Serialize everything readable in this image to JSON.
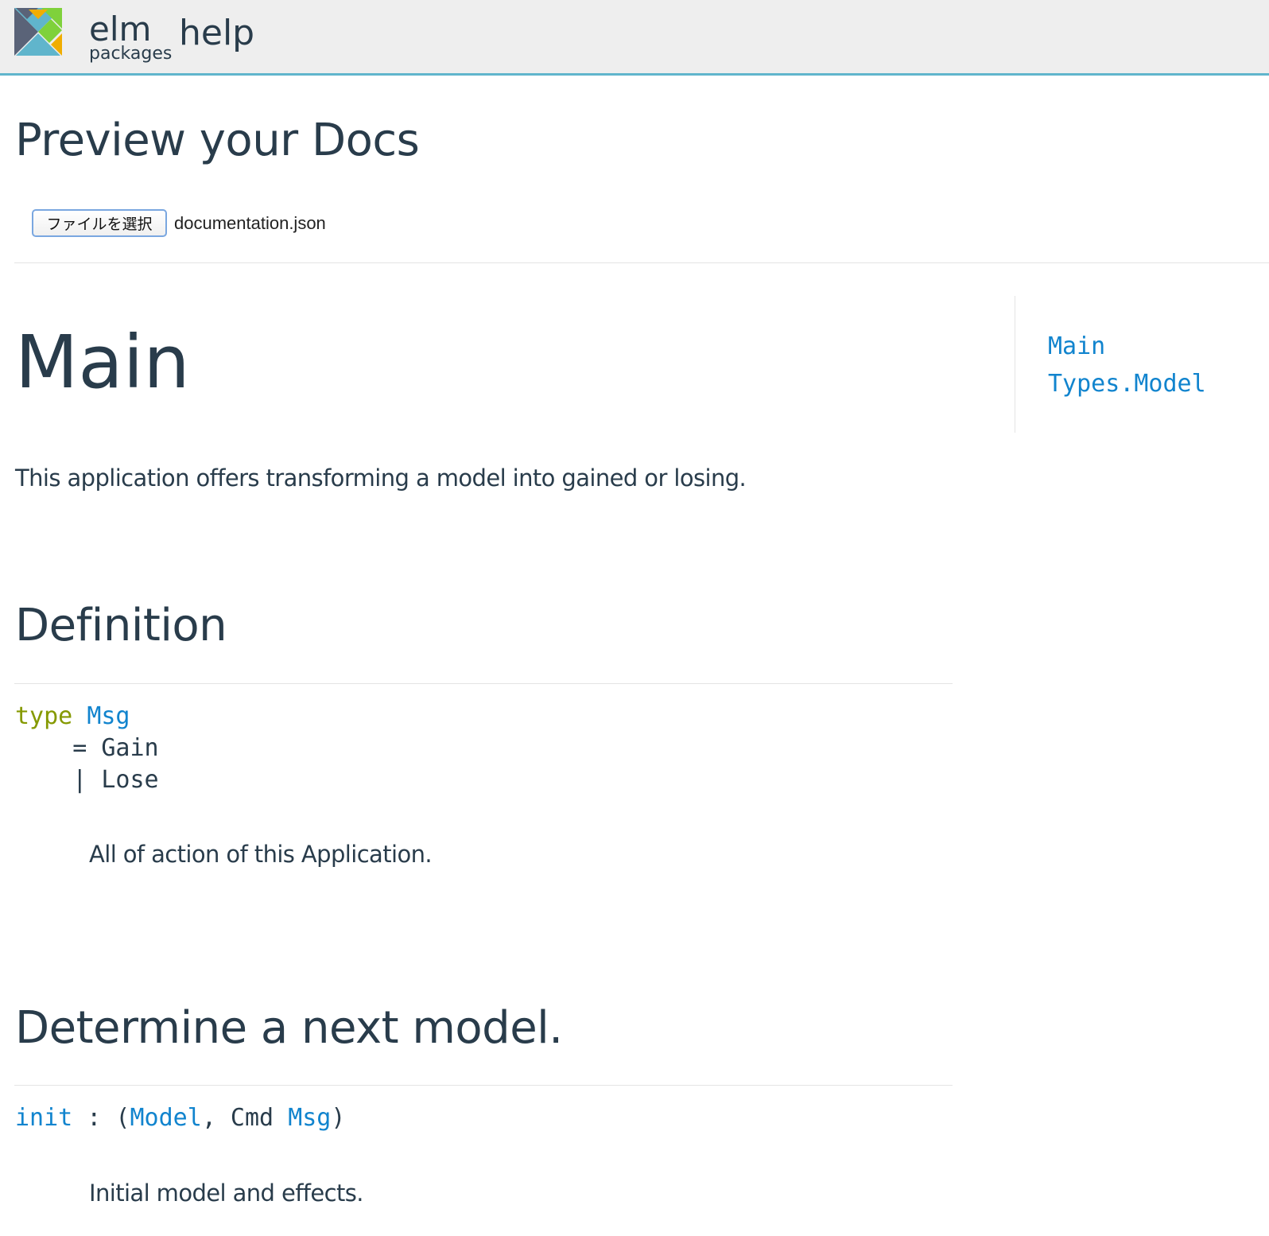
{
  "header": {
    "logo_elm": "elm",
    "logo_packages": "packages",
    "help_link": "help",
    "colors": {
      "background": "#eeeeee",
      "accent_border": "#60b5cc",
      "logo_green": "#7fd13b",
      "logo_orange": "#f0ad00",
      "logo_blue": "#60b5cc",
      "logo_slate": "#5a6378"
    }
  },
  "page": {
    "title": "Preview your Docs"
  },
  "file_input": {
    "button_label": "ファイルを選択",
    "file_name": "documentation.json"
  },
  "module": {
    "title": "Main",
    "description": "This application offers transforming a model into gained or losing."
  },
  "sidebar": {
    "links": [
      "Main",
      "Types.Model"
    ],
    "link_color": "#1184ce"
  },
  "sections": [
    {
      "heading": "Definition",
      "code": {
        "keyword": "type",
        "name": "Msg",
        "line2_prefix": "    = ",
        "line2_value": "Gain",
        "line3_prefix": "    | ",
        "line3_value": "Lose"
      },
      "doc": "All of action of this Application."
    },
    {
      "heading": "Determine a next model.",
      "code": {
        "name": "init",
        "sep": " : (",
        "type1": "Model",
        "comma": ", Cmd ",
        "type2": "Msg",
        "close": ")"
      },
      "doc": "Initial model and effects."
    }
  ],
  "code_colors": {
    "keyword": "#859900",
    "type_name": "#1184ce",
    "text": "#293c4b"
  }
}
